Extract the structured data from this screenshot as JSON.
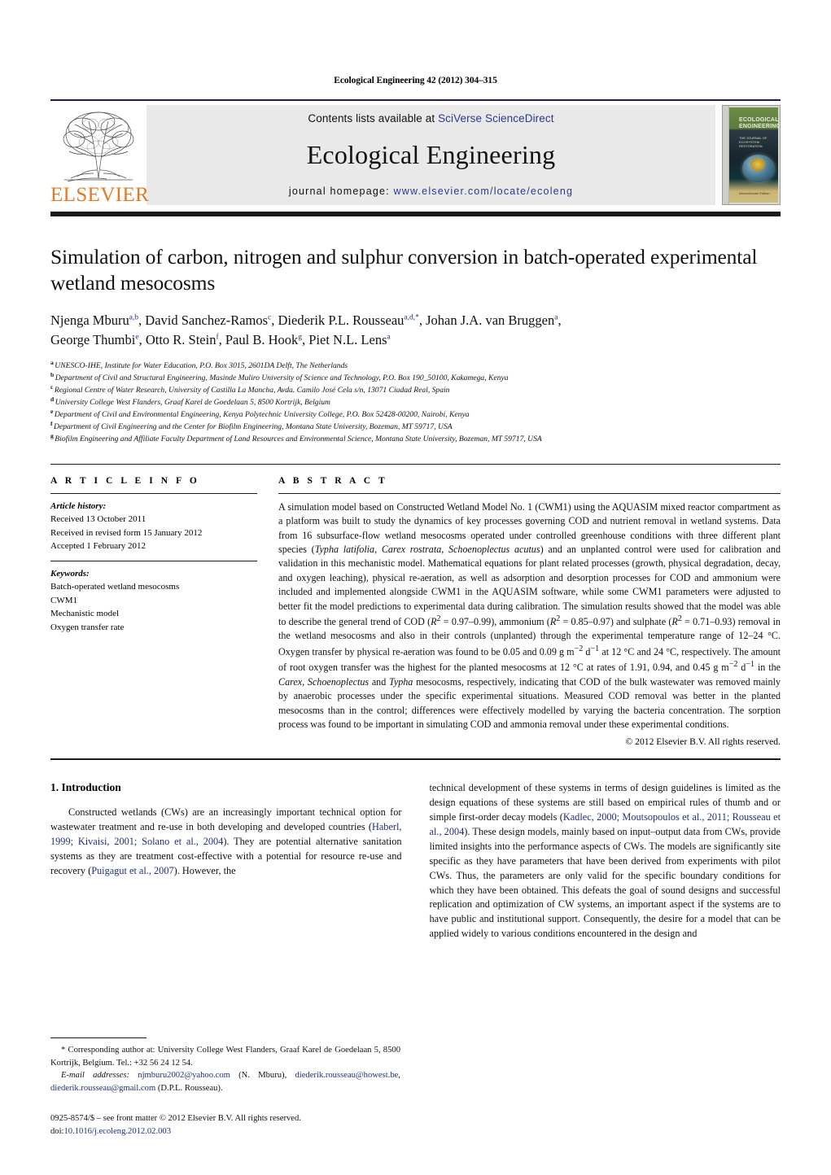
{
  "running_head": "Ecological Engineering 42 (2012) 304–315",
  "header": {
    "contents_prefix": "Contents lists available at ",
    "contents_link": "SciVerse ScienceDirect",
    "journal_title": "Ecological Engineering",
    "homepage_prefix": "journal homepage: ",
    "homepage_url": "www.elsevier.com/locate/ecoleng",
    "publisher": "ELSEVIER",
    "cover": {
      "title": "ECOLOGICAL ENGINEERING",
      "subtitle": "THE JOURNAL OF ECOSYSTEM RESTORATION",
      "footer": "Internationale Edition"
    }
  },
  "article": {
    "title": "Simulation of carbon, nitrogen and sulphur conversion in batch-operated experimental wetland mesocosms",
    "authors_line1": "Njenga Mburu",
    "authors": [
      {
        "name": "Njenga Mburu",
        "sup": "a,b"
      },
      {
        "name": "David Sanchez-Ramos",
        "sup": "c"
      },
      {
        "name": "Diederik P.L. Rousseau",
        "sup": "a,d,*"
      },
      {
        "name": "Johan J.A. van Bruggen",
        "sup": "a"
      },
      {
        "name": "George Thumbi",
        "sup": "e"
      },
      {
        "name": "Otto R. Stein",
        "sup": "f"
      },
      {
        "name": "Paul B. Hook",
        "sup": "g"
      },
      {
        "name": "Piet N.L. Lens",
        "sup": "a"
      }
    ],
    "affiliations": [
      {
        "mark": "a",
        "text": "UNESCO-IHE, Institute for Water Education, P.O. Box 3015, 2601DA Delft, The Netherlands"
      },
      {
        "mark": "b",
        "text": "Department of Civil and Structural Engineering, Masinde Muliro University of Science and Technology, P.O. Box 190_50100, Kakamega, Kenya"
      },
      {
        "mark": "c",
        "text": "Regional Centre of Water Research, University of Castilla La Mancha, Avda. Camilo José Cela s/n, 13071 Ciudad Real, Spain"
      },
      {
        "mark": "d",
        "text": "University College West Flanders, Graaf Karel de Goedelaan 5, 8500 Kortrijk, Belgium"
      },
      {
        "mark": "e",
        "text": "Department of Civil and Environmental Engineering, Kenya Polytechnic University College, P.O. Box 52428-00200, Nairobi, Kenya"
      },
      {
        "mark": "f",
        "text": "Department of Civil Engineering and the Center for Biofilm Engineering, Montana State University, Bozeman, MT 59717, USA"
      },
      {
        "mark": "g",
        "text": "Biofilm Engineering and Affiliate Faculty Department of Land Resources and Environmental Science, Montana State University, Bozeman, MT 59717, USA"
      }
    ]
  },
  "info": {
    "heading": "A R T I C L E  I N F O",
    "history_label": "Article history:",
    "history": [
      "Received 13 October 2011",
      "Received in revised form 15 January 2012",
      "Accepted 1 February 2012"
    ],
    "keywords_label": "Keywords:",
    "keywords": [
      "Batch-operated wetland mesocosms",
      "CWM1",
      "Mechanistic model",
      "Oxygen transfer rate"
    ]
  },
  "abstract": {
    "heading": "A B S T R A C T",
    "copyright": "© 2012 Elsevier B.V. All rights reserved."
  },
  "intro": {
    "heading": "1.  Introduction",
    "left_p1_a": "Constructed wetlands (CWs) are an increasingly important technical option for wastewater treatment and re-use in both developing and developed countries (",
    "left_ref1": "Haberl, 1999; Kivaisi, 2001; Solano et al., 2004",
    "left_p1_b": "). They are potential alternative sanitation systems as they are treatment cost-effective with a potential for resource re-use and recovery (",
    "left_ref2": "Puigagut et al., 2007",
    "left_p1_c": "). However, the",
    "right_a": "technical development of these systems in terms of design guidelines is limited as the design equations of these systems are still based on empirical rules of thumb and or simple first-order decay models (",
    "right_ref1": "Kadlec, 2000; Moutsopoulos et al., 2011; Rousseau et al., 2004",
    "right_b": "). These design models, mainly based on input–output data from CWs, provide limited insights into the performance aspects of CWs. The models are significantly site specific as they have parameters that have been derived from experiments with pilot CWs. Thus, the parameters are only valid for the specific boundary conditions for which they have been obtained. This defeats the goal of sound designs and successful replication and optimization of CW systems, an important aspect if the systems are to have public and institutional support. Consequently, the desire for a model that can be applied widely to various conditions encountered in the design and"
  },
  "footnote": {
    "star": "*",
    "corresp": "Corresponding author at: University College West Flanders, Graaf Karel de Goedelaan 5, 8500 Kortrijk, Belgium. Tel.: +32 56 24 12 54.",
    "email_label": "E-mail addresses:",
    "email1": "njmburu2002@yahoo.com",
    "email1_who": "(N. Mburu),",
    "email2": "diederik.rousseau@howest.be",
    "email3": "diederik.rousseau@gmail.com",
    "email_who2": "(D.P.L. Rousseau)."
  },
  "imprint": {
    "line1": "0925-8574/$ – see front matter © 2012 Elsevier B.V. All rights reserved.",
    "doi_label": "doi:",
    "doi": "10.1016/j.ecoleng.2012.02.003"
  },
  "colors": {
    "link": "#1f2f7a",
    "elsevier_orange": "#e87722",
    "header_band": "#e9e9e9"
  }
}
